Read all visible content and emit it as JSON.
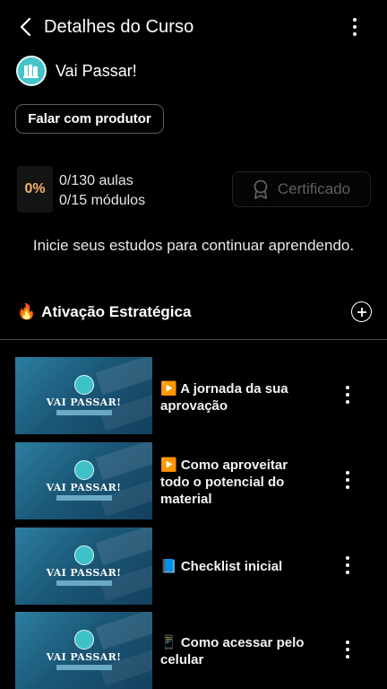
{
  "header": {
    "title": "Detalhes do Curso",
    "back_icon": "chevron-left-icon",
    "menu_icon": "more-vertical-icon"
  },
  "product": {
    "name": "Vai Passar!",
    "logo_color": "#43c4c9"
  },
  "contact_button": "Falar com produtor",
  "progress": {
    "percent_label": "0%",
    "lessons": "0/130 aulas",
    "modules": "0/15 módulos"
  },
  "certificate_button": "Certificado",
  "info_message": "Inicie seus estudos para continuar aprendendo.",
  "module": {
    "emoji": "🔥",
    "title": "Ativação Estratégica"
  },
  "thumbnail": {
    "title": "VAI PASSAR!"
  },
  "lessons": [
    {
      "line1": "▶️ A jornada da sua",
      "line2": "aprovação",
      "line3": ""
    },
    {
      "line1": "▶️ Como aproveitar",
      "line2": "todo o potencial do",
      "line3": "material"
    },
    {
      "line1": "📘 Checklist inicial",
      "line2": "",
      "line3": ""
    },
    {
      "line1": "📱 Como acessar pelo",
      "line2": "celular",
      "line3": ""
    }
  ],
  "colors": {
    "background": "#000000",
    "accent_percent": "#f3b16b",
    "thumbnail_blue": "#1b5878"
  }
}
